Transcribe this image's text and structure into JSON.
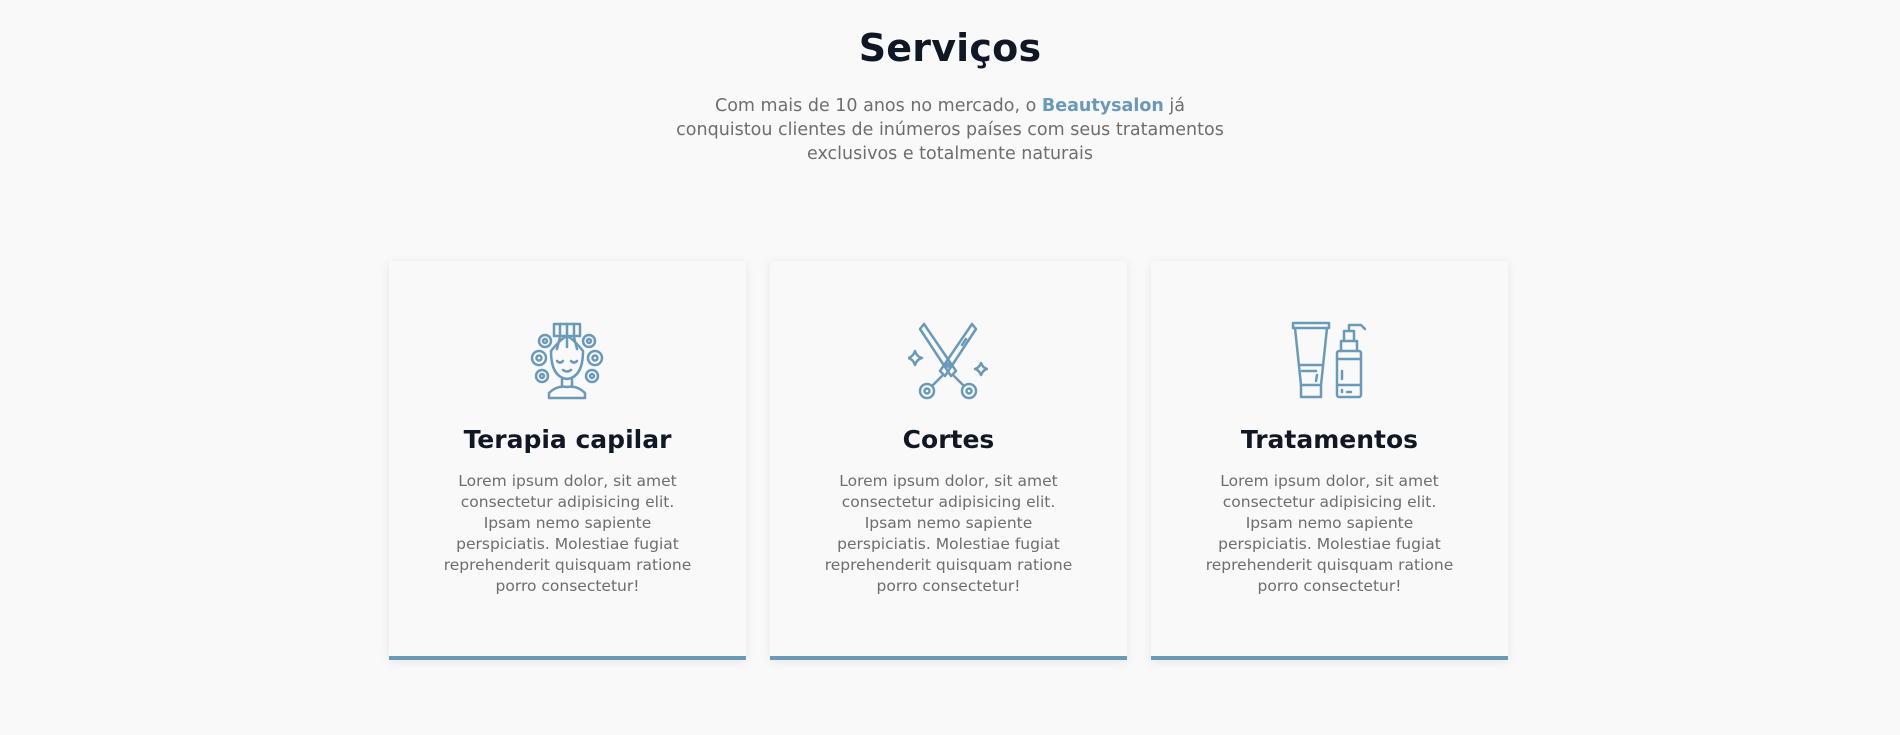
{
  "section": {
    "title": "Serviços",
    "intro_before": "Com mais de 10 anos no mercado, o ",
    "brand": "Beautysalon",
    "intro_after": " já conquistou clientes de inúmeros países com seus tratamentos exclusivos e totalmente naturais"
  },
  "cards": [
    {
      "icon": "hair-curlers-icon",
      "title": "Terapia capilar",
      "text": "Lorem ipsum dolor, sit amet consectetur adipisicing elit. Ipsam nemo sapiente perspiciatis. Molestiae fugiat reprehenderit quisquam ratione porro consectetur!"
    },
    {
      "icon": "scissors-icon",
      "title": "Cortes",
      "text": "Lorem ipsum dolor, sit amet consectetur adipisicing elit. Ipsam nemo sapiente perspiciatis. Molestiae fugiat reprehenderit quisquam ratione porro consectetur!"
    },
    {
      "icon": "cosmetic-bottles-icon",
      "title": "Tratamentos",
      "text": "Lorem ipsum dolor, sit amet consectetur adipisicing elit. Ipsam nemo sapiente perspiciatis. Molestiae fugiat reprehenderit quisquam ratione porro consectetur!"
    }
  ],
  "colors": {
    "accent": "#6a9ab8",
    "heading": "#101826",
    "body_text": "#6e6e6e",
    "background": "#f9f9f9"
  }
}
